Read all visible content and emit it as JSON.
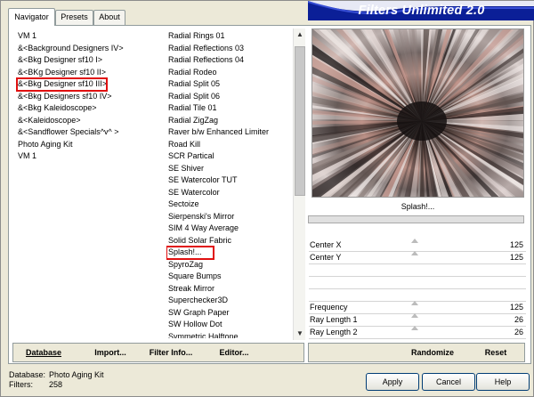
{
  "tabs": [
    "Navigator",
    "Presets",
    "About"
  ],
  "banner": {
    "title": "Filters Unlimited 2.0",
    "color": "#0b1f97"
  },
  "categories": [
    "VM 1",
    "&<Background Designers IV>",
    "&<Bkg Designer sf10 I>",
    "&<BKg Designer sf10 II>",
    "&<Bkg Designer sf10 III>",
    "&<Bkg Designers sf10 IV>",
    "&<Bkg Kaleidoscope>",
    "&<Kaleidoscope>",
    "&<Sandflower Specials^v^ >",
    "Photo Aging Kit",
    "VM 1"
  ],
  "selected_category_index": 4,
  "filters": [
    "Radial  Rings 01",
    "Radial Reflections 03",
    "Radial Reflections 04",
    "Radial Rodeo",
    "Radial Split 05",
    "Radial Split 06",
    "Radial Tile 01",
    "Radial ZigZag",
    "Raver b/w Enhanced Limiter",
    "Road Kill",
    "SCR  Partical",
    "SE Shiver",
    "SE Watercolor TUT",
    "SE Watercolor",
    "Sectoize",
    "Sierpenski's Mirror",
    "SIM 4 Way Average",
    "Solid Solar Fabric",
    "Splash!...",
    "SpyroZag",
    "Square Bumps",
    "Streak Mirror",
    "Superchecker3D",
    "SW Graph Paper",
    "SW Hollow Dot",
    "Symmetric Halftone"
  ],
  "selected_filter_index": 18,
  "preview": {
    "filter_name": "Splash!..."
  },
  "sliders": [
    {
      "label": "Center X",
      "value": "125"
    },
    {
      "label": "Center Y",
      "value": "125"
    },
    {
      "label": "",
      "value": ""
    },
    {
      "label": "",
      "value": ""
    },
    {
      "label": "",
      "value": ""
    },
    {
      "label": "Frequency",
      "value": "125"
    },
    {
      "label": "Ray Length 1",
      "value": "26"
    },
    {
      "label": "Ray Length 2",
      "value": "26"
    }
  ],
  "bottom_buttons": {
    "database": "Database",
    "import": "Import...",
    "filter_info": "Filter Info...",
    "editor": "Editor...",
    "randomize": "Randomize",
    "reset": "Reset"
  },
  "footer": {
    "database_label": "Database:",
    "database_value": "Photo Aging Kit",
    "filters_label": "Filters:",
    "filters_value": "258"
  },
  "dialog_buttons": {
    "apply": "Apply",
    "cancel": "Cancel",
    "help": "Help"
  }
}
